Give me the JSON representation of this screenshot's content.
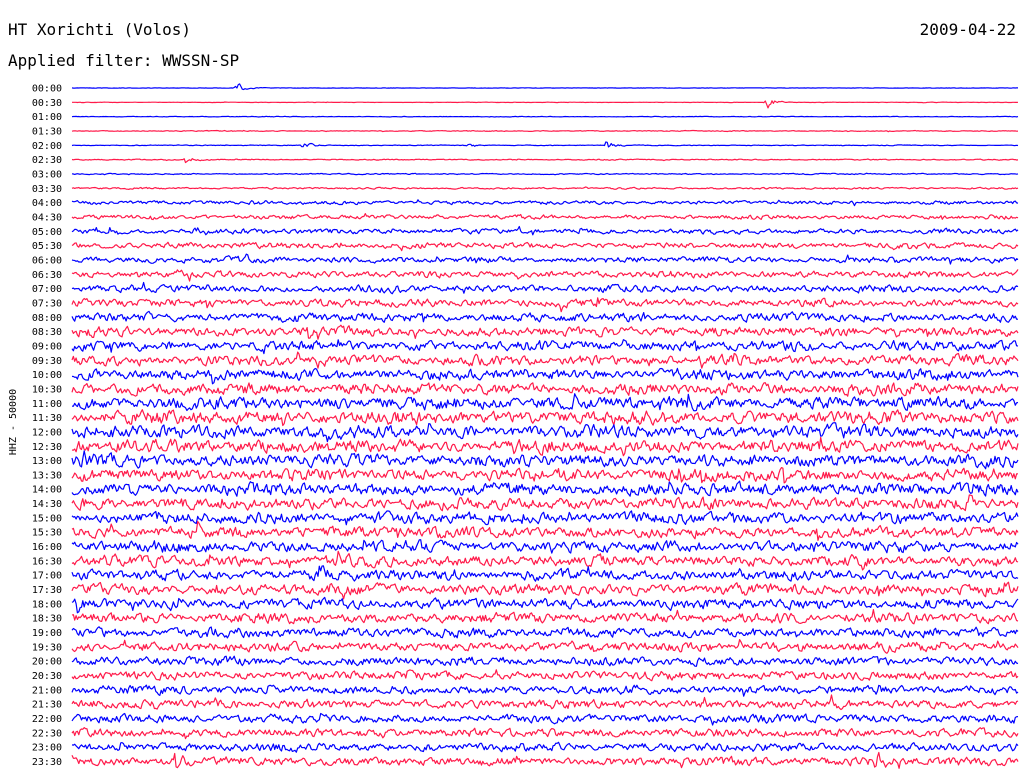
{
  "header": {
    "station": "HT Xorichti (Volos)",
    "date": "2009-04-22",
    "filter": "Applied filter: WWSSN-SP"
  },
  "channel_label": "HHZ - 50000",
  "colors": {
    "trace_even": "#0000ff",
    "trace_odd": "#ff1a4a",
    "background": "#ffffff",
    "text": "#000000"
  },
  "chart_data": {
    "type": "line",
    "title": "HT Xorichti (Volos)",
    "subtitle": "Applied filter: WWSSN-SP",
    "ylabel": "HHZ - 50000",
    "rows": [
      "00:00",
      "00:30",
      "01:00",
      "01:30",
      "02:00",
      "02:30",
      "03:00",
      "03:30",
      "04:00",
      "04:30",
      "05:00",
      "05:30",
      "06:00",
      "06:30",
      "07:00",
      "07:30",
      "08:00",
      "08:30",
      "09:00",
      "09:30",
      "10:00",
      "10:30",
      "11:00",
      "11:30",
      "12:00",
      "12:30",
      "13:00",
      "13:30",
      "14:00",
      "14:30",
      "15:00",
      "15:30",
      "16:00",
      "16:30",
      "17:00",
      "17:30",
      "18:00",
      "18:30",
      "19:00",
      "19:30",
      "20:00",
      "20:30",
      "21:00",
      "21:30",
      "22:00",
      "22:30",
      "23:00",
      "23:30"
    ],
    "noise_level": [
      0.3,
      0.3,
      0.4,
      0.6,
      0.5,
      0.7,
      0.8,
      1.2,
      2.6,
      3.0,
      3.5,
      4.0,
      4.2,
      4.5,
      5.0,
      5.5,
      6.0,
      6.5,
      6.8,
      7.0,
      7.5,
      8.0,
      8.5,
      9.0,
      9.0,
      9.0,
      8.8,
      8.5,
      8.5,
      8.2,
      8.0,
      7.8,
      7.8,
      7.6,
      7.5,
      7.4,
      7.2,
      7.0,
      6.8,
      6.5,
      6.2,
      6.0,
      6.0,
      6.0,
      5.8,
      5.8,
      5.8,
      6.0
    ],
    "events": [
      {
        "row": "00:00",
        "position": 0.175,
        "amplitude": 8
      },
      {
        "row": "00:30",
        "position": 0.735,
        "amplitude": 10
      },
      {
        "row": "02:00",
        "position": 0.245,
        "amplitude": 6
      },
      {
        "row": "02:00",
        "position": 0.42,
        "amplitude": 4
      },
      {
        "row": "02:00",
        "position": 0.565,
        "amplitude": 9
      },
      {
        "row": "02:30",
        "position": 0.12,
        "amplitude": 7
      },
      {
        "row": "04:00",
        "position": 0.19,
        "amplitude": 8
      },
      {
        "row": "05:00",
        "position": 0.13,
        "amplitude": 10
      },
      {
        "row": "17:00",
        "position": 0.26,
        "amplitude": 14
      },
      {
        "row": "23:30",
        "position": 0.11,
        "amplitude": 18
      },
      {
        "row": "23:30",
        "position": 0.85,
        "amplitude": 16
      }
    ],
    "grid": false,
    "legend": "none"
  }
}
